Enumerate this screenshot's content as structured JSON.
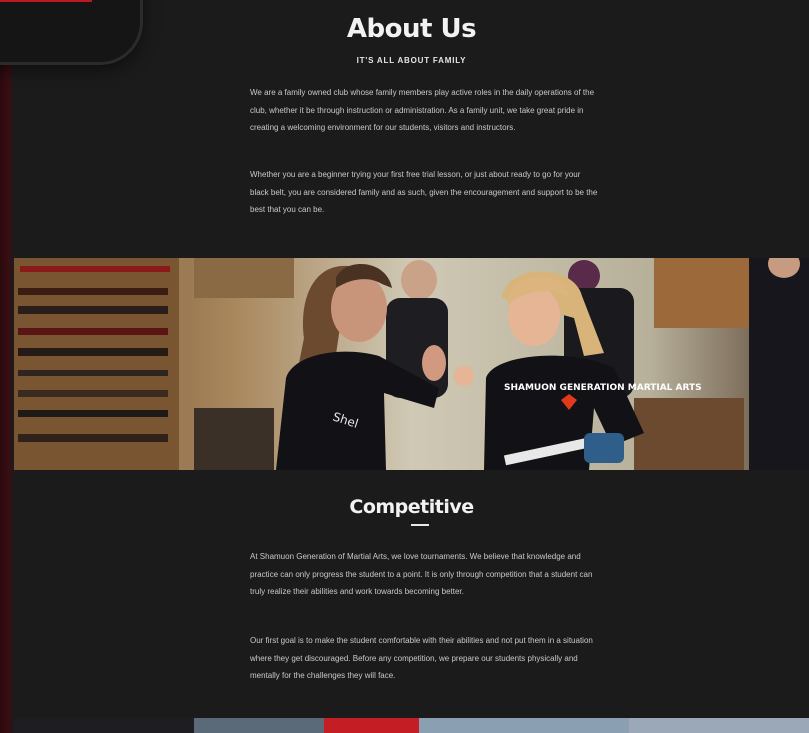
{
  "about": {
    "title": "About Us",
    "subtitle": "IT'S ALL ABOUT FAMILY",
    "paragraphs": [
      "We are a family owned club whose family members play active roles in the daily operations of the club, whether it be through instruction or administration. As a family unit, we take great pride in creating a welcoming environment for our students, visitors and instructors.",
      "Whether you are a beginner trying your first free trial lesson, or just about ready to go for your black belt, you are considered family and as such, given the encouragement and support to be the best that you can be."
    ]
  },
  "hero_image": {
    "shirt_text": "SHAMUON GENERATION MARTIAL ARTS"
  },
  "competitive": {
    "title": "Competitive",
    "paragraphs": [
      "At Shamuon Generation of Martial Arts, we love tournaments. We believe that knowledge and practice can only progress the student to a point. It is only through competition that a student can truly realize their abilities and work towards becoming better.",
      "Our first goal is to make the student comfortable with their abilities and not put them in a situation where they get discouraged. Before any competition, we prepare our students physically and mentally for the challenges they will face."
    ]
  },
  "colors": {
    "background": "#1b1b1b",
    "accent_red": "#c0181f",
    "heading": "#f2f2f2",
    "body_text": "#c9c9c9"
  }
}
